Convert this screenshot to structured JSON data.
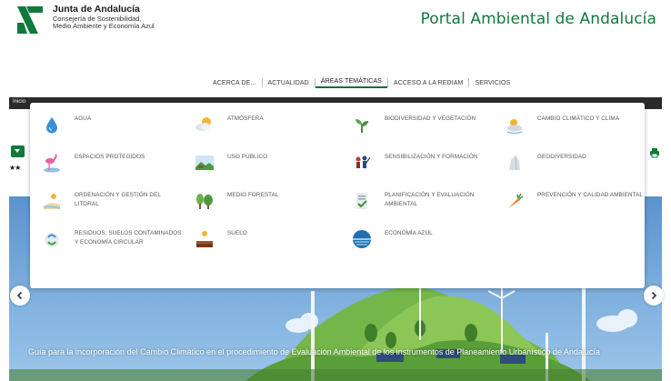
{
  "header": {
    "brand_name": "Junta de Andalucía",
    "brand_sub1": "Consejería de Sostenibilidad,",
    "brand_sub2": "Medio Ambiente y Economía Azul",
    "portal_title": "Portal Ambiental de Andalucía"
  },
  "nav": {
    "items": [
      "ACERCA DE...",
      "ACTUALIDAD",
      "ÁREAS TEMÁTICAS",
      "ACCESO A LA REDIAM",
      "SERVICIOS"
    ],
    "active_index": 2
  },
  "strip": {
    "label": "Inicio"
  },
  "dropdown": {
    "items": [
      {
        "label": "AGUA",
        "icon": "water-drop-icon"
      },
      {
        "label": "ATMÓSFERA",
        "icon": "sun-cloud-icon"
      },
      {
        "label": "BIODIVERSIDAD Y VEGETACIÓN",
        "icon": "plant-icon"
      },
      {
        "label": "CAMBIO CLIMÁTICO Y CLIMA",
        "icon": "climate-icon"
      },
      {
        "label": "ESPACIOS PROTEGIDOS",
        "icon": "flamingo-icon"
      },
      {
        "label": "USO PÚBLICO",
        "icon": "landscape-icon"
      },
      {
        "label": "SENSIBILIZACIÓN Y FORMACIÓN",
        "icon": "people-icon"
      },
      {
        "label": "GEODIVERSIDAD",
        "icon": "rock-icon"
      },
      {
        "label": "ORDENACIÓN Y GESTIÓN DEL LITORAL",
        "icon": "coast-icon"
      },
      {
        "label": "MEDIO FORESTAL",
        "icon": "trees-icon"
      },
      {
        "label": "PLANIFICACIÓN Y EVALUACIÓN AMBIENTAL",
        "icon": "planning-icon"
      },
      {
        "label": "PREVENCIÓN Y CALIDAD AMBIENTAL",
        "icon": "carrot-icon"
      },
      {
        "label": "RESIDUOS, SUELOS CONTAMINADOS Y ECONOMÍA CIRCULAR",
        "icon": "recycle-icon"
      },
      {
        "label": "SUELO",
        "icon": "soil-icon"
      },
      {
        "label": "ECONOMÍA AZUL",
        "icon": "blue-economy-icon"
      }
    ]
  },
  "banner": {
    "caption": "Guía para la incorporación del Cambio Climático en el procedimiento de Evaluación Ambiental de los instrumentos de Planeamiento Urbanístico de Andalucía"
  },
  "rating": {
    "stars": "★★"
  },
  "colors": {
    "brand_green": "#0f7a3c",
    "strip": "#2b2b2b",
    "sky": "#6fa4d6"
  }
}
